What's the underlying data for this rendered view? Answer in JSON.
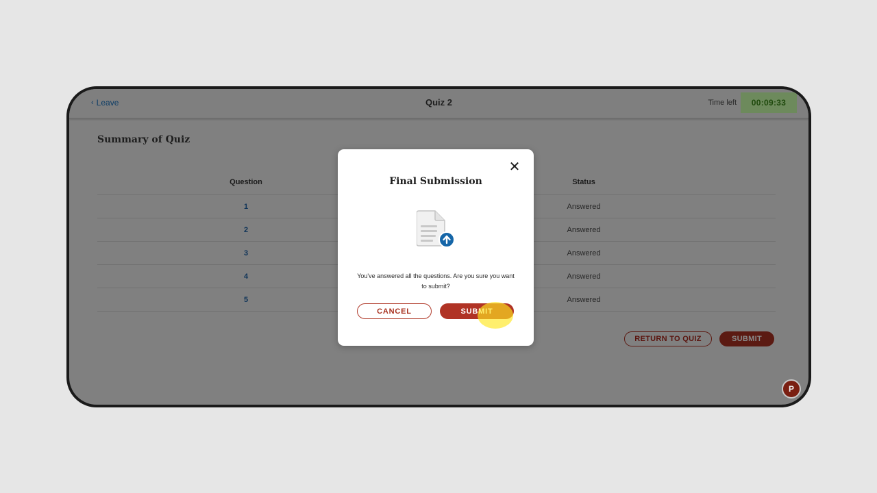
{
  "header": {
    "leave_label": "Leave",
    "title": "Quiz 2",
    "time_label": "Time left",
    "timer": "00:09:33"
  },
  "summary": {
    "title": "Summary of Quiz",
    "columns": [
      "Question",
      "Status"
    ],
    "rows": [
      {
        "question": "1",
        "status": "Answered"
      },
      {
        "question": "2",
        "status": "Answered"
      },
      {
        "question": "3",
        "status": "Answered"
      },
      {
        "question": "4",
        "status": "Answered"
      },
      {
        "question": "5",
        "status": "Answered"
      }
    ],
    "return_label": "RETURN TO QUIZ",
    "submit_label": "SUBMIT"
  },
  "help_icon": "P",
  "modal": {
    "title": "Final Submission",
    "icon": "document-upload-icon",
    "message": "You've answered all the questions. Are you sure you want to submit?",
    "cancel_label": "CANCEL",
    "submit_label": "SUBMIT",
    "close_icon": "close-icon"
  },
  "colors": {
    "accent": "#b03325",
    "link": "#0e3358",
    "upload_badge": "#1566a8",
    "timer_bg": "#6d8a5c"
  }
}
